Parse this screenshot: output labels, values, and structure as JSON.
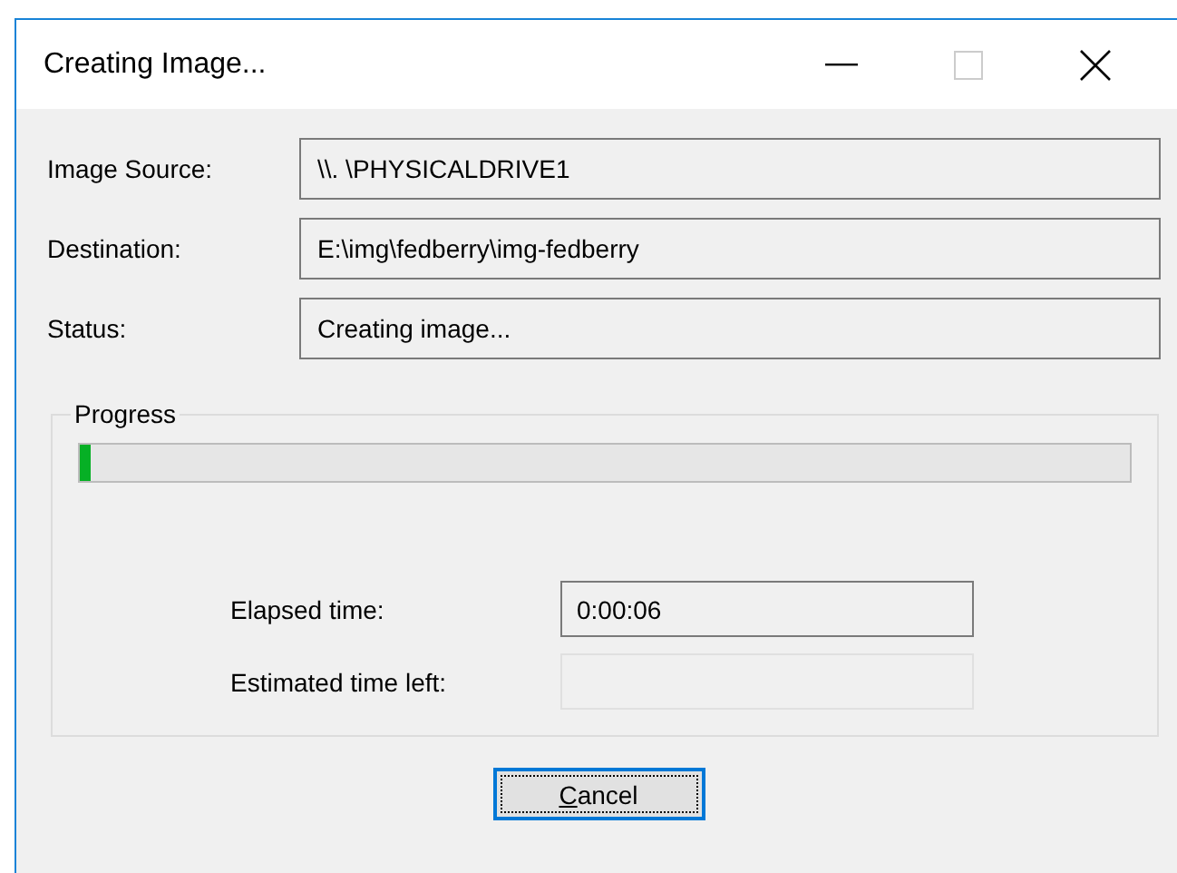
{
  "window": {
    "title": "Creating Image...",
    "controls": [
      {
        "kind": "minimize",
        "disabled": false
      },
      {
        "kind": "maximize",
        "disabled": true
      },
      {
        "kind": "close",
        "disabled": false
      }
    ]
  },
  "fields": [
    {
      "label": "Image Source:",
      "value": "\\\\. \\PHYSICALDRIVE1"
    },
    {
      "label": "Destination:",
      "value": "E:\\img\\fedberry\\img-fedberry"
    },
    {
      "label": "Status:",
      "value": "Creating image..."
    }
  ],
  "progress": {
    "title": "Progress",
    "level": 0.01,
    "times": [
      {
        "label": "Elapsed time:",
        "value": "0:00:06",
        "disabled": false
      },
      {
        "label": "Estimated time left:",
        "disabled": true
      }
    ]
  },
  "button": {
    "label": "Cancel",
    "focused": true
  }
}
